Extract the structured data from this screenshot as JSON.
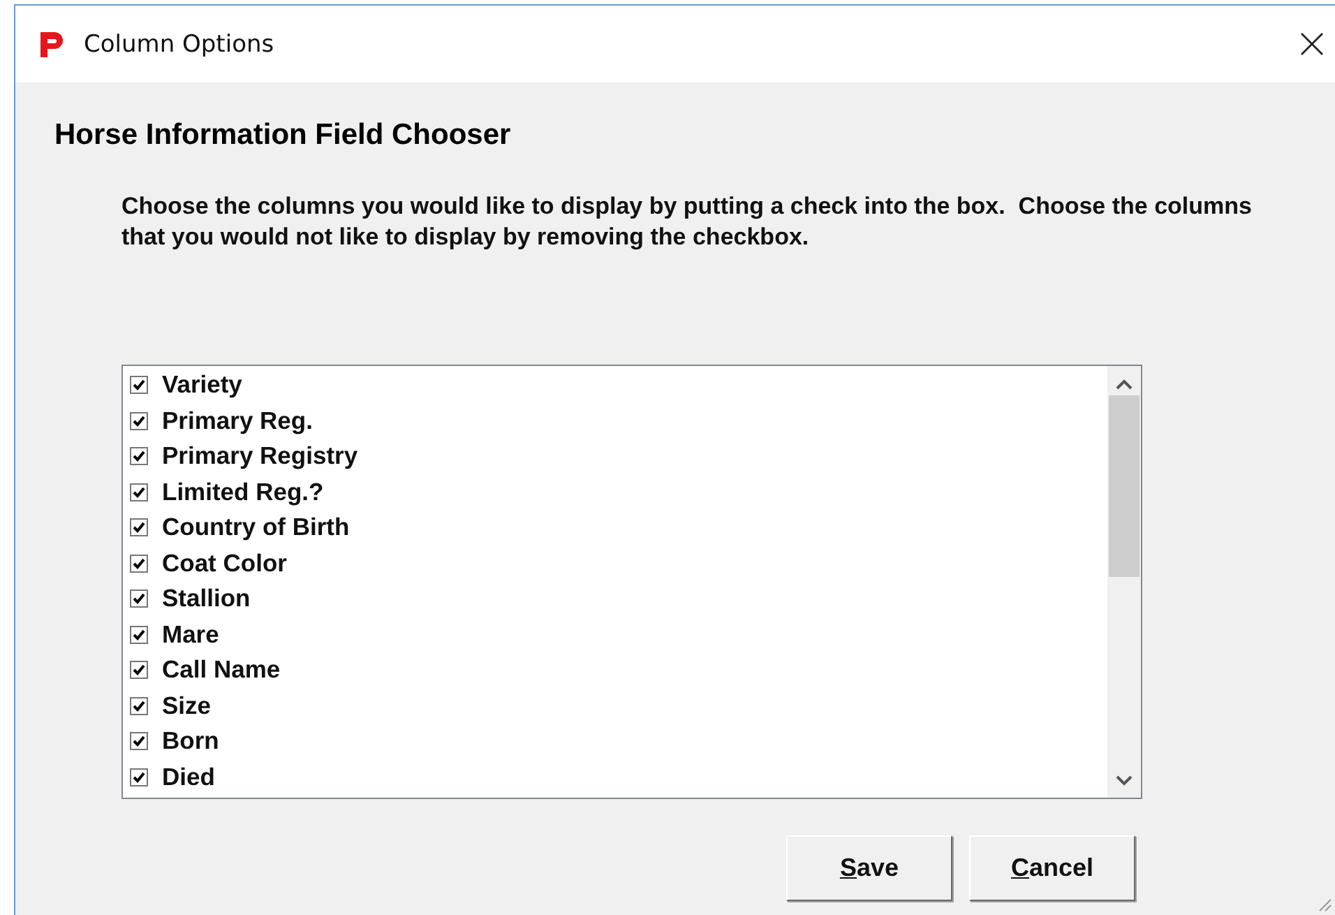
{
  "window": {
    "title": "Column Options"
  },
  "heading": "Horse Information Field Chooser",
  "instructions": "Choose the columns you would like to display by putting a check into the box.  Choose the columns that you would not like to display by removing the checkbox.",
  "fields": [
    {
      "label": "Variety",
      "checked": true
    },
    {
      "label": "Primary Reg.",
      "checked": true
    },
    {
      "label": "Primary Registry",
      "checked": true
    },
    {
      "label": "Limited Reg.?",
      "checked": true
    },
    {
      "label": "Country of Birth",
      "checked": true
    },
    {
      "label": "Coat Color",
      "checked": true
    },
    {
      "label": "Stallion",
      "checked": true
    },
    {
      "label": "Mare",
      "checked": true
    },
    {
      "label": "Call Name",
      "checked": true
    },
    {
      "label": "Size",
      "checked": true
    },
    {
      "label": "Born",
      "checked": true
    },
    {
      "label": "Died",
      "checked": true
    }
  ],
  "buttons": [
    {
      "label": "Save",
      "mnemonic": true
    },
    {
      "label": "Cancel",
      "mnemonic": true
    }
  ]
}
